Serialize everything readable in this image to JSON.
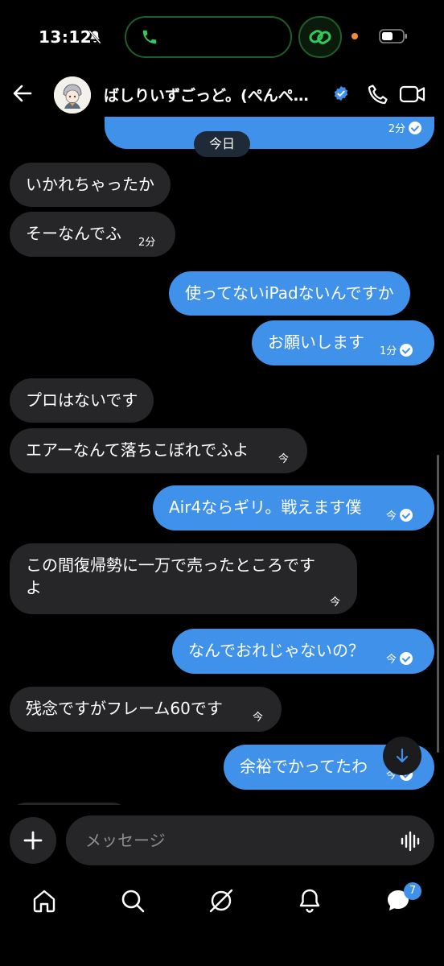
{
  "status_bar": {
    "time": "13:12"
  },
  "header": {
    "title": "ばしりいずごっど。(ぺんぺ…"
  },
  "date_chip": "今日",
  "messages": [
    {
      "dir": "out",
      "text": "",
      "time": "2分",
      "read": true
    },
    {
      "dir": "in",
      "text": "いかれちゃったか",
      "time": ""
    },
    {
      "dir": "in",
      "text": "そーなんでふ",
      "time": "2分"
    },
    {
      "dir": "out",
      "text": "使ってないiPadないんですか",
      "time": ""
    },
    {
      "dir": "out",
      "text": "お願いします",
      "time": "1分",
      "read": true
    },
    {
      "dir": "in",
      "text": "プロはないです",
      "time": ""
    },
    {
      "dir": "in",
      "text": "エアーなんて落ちこぼれでふよ",
      "time": "今"
    },
    {
      "dir": "out",
      "text": "Air4ならギリ。戦えます僕",
      "time": "今",
      "read": true
    },
    {
      "dir": "in",
      "text_line1": "この間復帰勢に一万で売ったところです",
      "text_line2": "よ",
      "time": "今"
    },
    {
      "dir": "out",
      "text": "なんでおれじゃないの？",
      "time": "今",
      "read": true
    },
    {
      "dir": "in",
      "text": "残念ですがフレーム60です",
      "time": "今"
    },
    {
      "dir": "out",
      "text": "余裕でかってたわ",
      "time": "今",
      "read": true
    }
  ],
  "composer": {
    "placeholder": "メッセージ"
  },
  "nav": {
    "badge_count": "7"
  },
  "colors": {
    "outgoing": "#3f91e9",
    "incoming": "#262628",
    "background": "#000000",
    "accent_green": "#34c759"
  }
}
